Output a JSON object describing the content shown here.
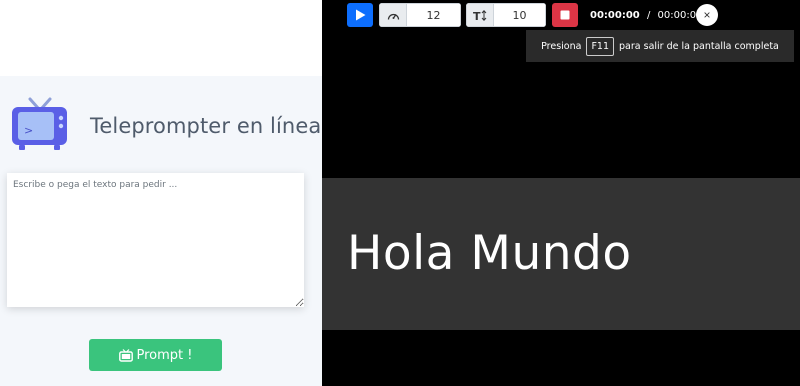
{
  "app": {
    "title": "Teleprompter en línea",
    "icon": "tv-icon"
  },
  "editor": {
    "placeholder": "Escribe o pega el texto para pedir ..."
  },
  "prompt_button": {
    "label": "Prompt !",
    "icon": "tv-icon",
    "color": "#3ac47d"
  },
  "toolbar": {
    "play_icon": "play-icon",
    "play_color": "#0d6efd",
    "speed": {
      "icon": "speedometer-icon",
      "value": "12"
    },
    "font_size": {
      "icon": "text-height-icon",
      "value": "10"
    },
    "stop_icon": "stop-icon",
    "stop_color": "#dc3545",
    "time_current": "00:00:00",
    "time_separator": "/",
    "time_total": "00:00:03",
    "close_label": "×"
  },
  "fullscreen_hint": {
    "before": "Presiona",
    "key": "F11",
    "after": "para salir de la pantalla completa"
  },
  "prompter": {
    "text": "Hola Mundo",
    "band_color": "#333333"
  }
}
